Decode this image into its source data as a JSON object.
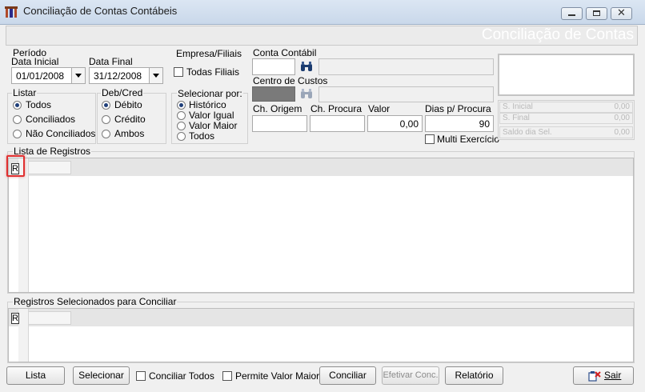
{
  "window": {
    "title": "Conciliação de Contas Contábeis",
    "banner": "Conciliação de Contas"
  },
  "periodo": {
    "label": "Período",
    "inicial_label": "Data Inicial",
    "inicial_value": "01/01/2008",
    "final_label": "Data Final",
    "final_value": "31/12/2008"
  },
  "empresa": {
    "label": "Empresa/Filiais",
    "todas_filiais": "Todas Filiais"
  },
  "conta": {
    "label": "Conta Contábil",
    "centro_label": "Centro de Custos"
  },
  "listar": {
    "label": "Listar",
    "options": [
      "Todos",
      "Conciliados",
      "Não Conciliados"
    ]
  },
  "debcred": {
    "label": "Deb/Cred",
    "options": [
      "Débito",
      "Crédito",
      "Ambos"
    ]
  },
  "selecionar": {
    "label": "Selecionar por:",
    "options": [
      "Histórico",
      "Valor Igual",
      "Valor Maior",
      "Todos"
    ]
  },
  "filtros": {
    "origem_label": "Ch. Origem",
    "procura_label": "Ch. Procura",
    "valor_label": "Valor",
    "valor_value": "0,00",
    "dias_label": "Dias p/ Procura",
    "dias_value": "90",
    "multi_label": "Multi Exercício"
  },
  "summary": {
    "rows": [
      {
        "label": "S. Inicial",
        "value": "0,00"
      },
      {
        "label": "S. Final",
        "value": "0,00"
      },
      {
        "label": "Saldo dia Sel.",
        "value": "0,00"
      }
    ]
  },
  "lista": {
    "label": "Lista de Registros",
    "row_button": "R"
  },
  "selecionados": {
    "label": "Registros Selecionados para Conciliar",
    "row_button": "R"
  },
  "toolbar": {
    "lista": "Lista",
    "selecionar": "Selecionar",
    "conciliar_todos": "Conciliar Todos",
    "permite_valor_maior": "Permite Valor Maior",
    "conciliar": "Conciliar",
    "efetivar": "Efetivar Conc.",
    "relatorio": "Relatório",
    "sair": "Sair"
  },
  "colors": {
    "highlight": "#e03030",
    "radio_dot": "#1f3f7a",
    "exit_icon": "#d42020"
  }
}
